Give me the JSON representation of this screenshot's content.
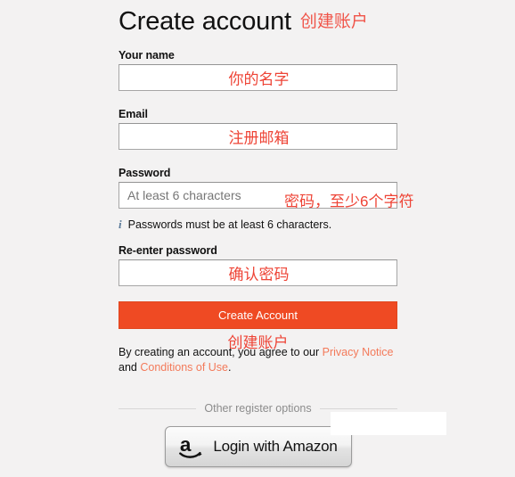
{
  "page": {
    "title": "Create account",
    "title_annotation": "创建账户",
    "background_color": "#f3f2f2",
    "accent_color": "#ef4a23",
    "annotation_color": "#ee4436"
  },
  "fields": [
    {
      "label": "Your name",
      "placeholder": "",
      "value": "",
      "annotation": "你的名字"
    },
    {
      "label": "Email",
      "placeholder": "",
      "value": "",
      "annotation": "注册邮箱"
    },
    {
      "label": "Password",
      "placeholder": "At least 6 characters",
      "value": "",
      "annotation": "密码，至少6个字符"
    },
    {
      "label": "Re-enter password",
      "placeholder": "",
      "value": "",
      "annotation": "确认密码"
    }
  ],
  "password_note": {
    "icon": "info-icon",
    "icon_glyph": "i",
    "text": "Passwords must be at least 6 characters."
  },
  "submit": {
    "label": "Create Account",
    "annotation": "创建账户"
  },
  "terms": {
    "prefix": "By creating an account, you agree to our ",
    "privacy_link": "Privacy Notice",
    "conjunction": " and ",
    "conditions_link": "Conditions of Use",
    "suffix": "."
  },
  "divider": {
    "text": "Other register options"
  },
  "amazon_button": {
    "label": "Login with Amazon",
    "icon": "amazon-logo-icon"
  }
}
